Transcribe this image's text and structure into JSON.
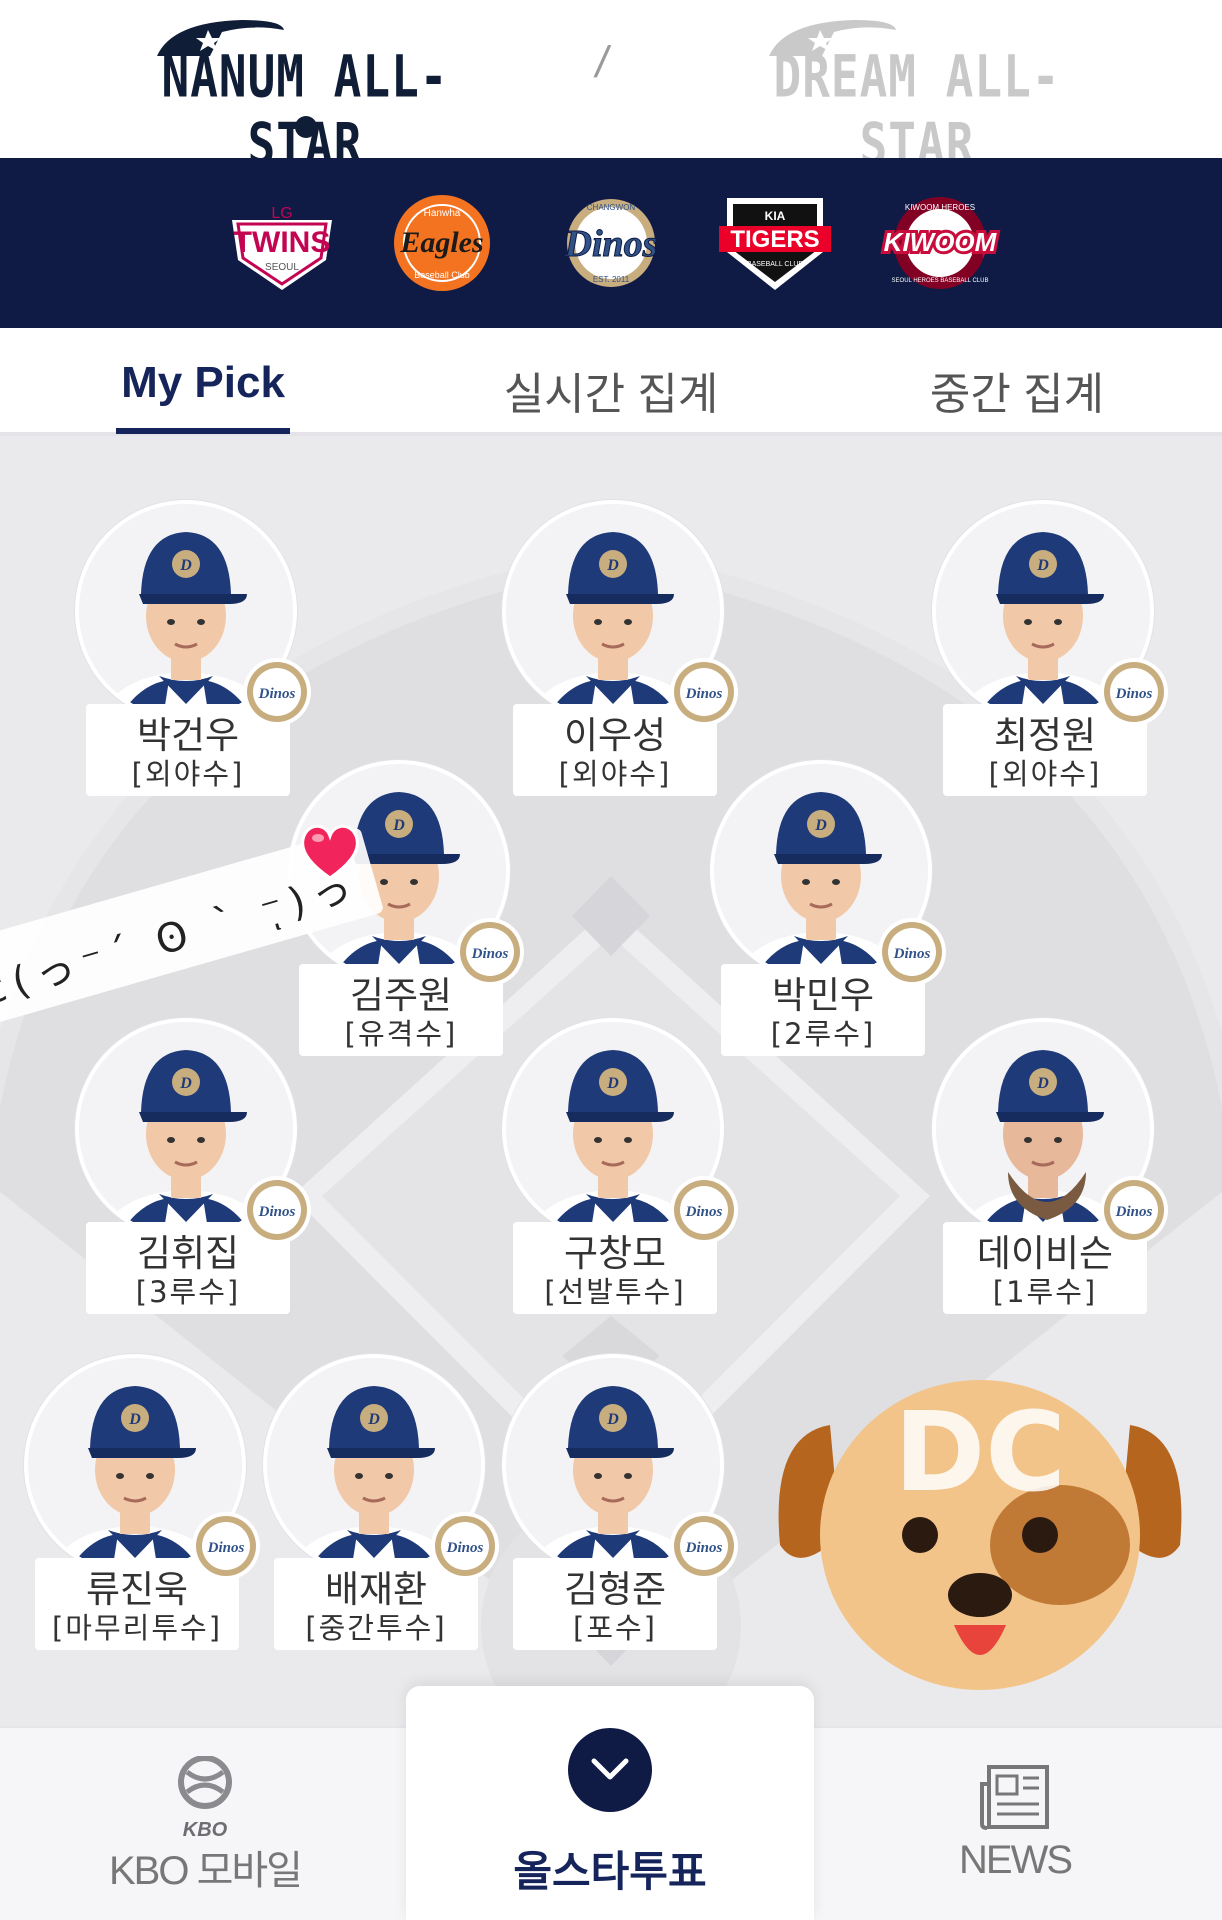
{
  "league_switcher": {
    "nanum": {
      "label": "NANUM ALL-STAR",
      "active": true
    },
    "separator": "/",
    "dream": {
      "label": "DREAM ALL-STAR",
      "active": false
    }
  },
  "teams": [
    {
      "name": "LG TWINS",
      "top": "LG",
      "main": "TWINS",
      "sub": "SEOUL",
      "color": "#c30452"
    },
    {
      "name": "Hanwha Eagles",
      "top": "Hanwha",
      "main": "Eagles",
      "sub": "Baseball Club",
      "color": "#f37321"
    },
    {
      "name": "NC Dinos",
      "top": "CHANGWON",
      "main": "Dinos",
      "sub": "EST. 2011",
      "color": "#315288"
    },
    {
      "name": "KIA TIGERS",
      "top": "KIA",
      "main": "TIGERS",
      "sub": "BASEBALL CLUB",
      "color": "#ea0029"
    },
    {
      "name": "KIWOOM HEROES",
      "top": "KIWOOM HEROES",
      "main": "KIWOOM",
      "sub": "SEOUL HEROES BASEBALL CLUB",
      "color": "#820024"
    }
  ],
  "tabs": [
    {
      "label": "My Pick",
      "active": true
    },
    {
      "label": "실시간 집계",
      "active": false
    },
    {
      "label": "중간 집계",
      "active": false
    }
  ],
  "players": [
    {
      "name": "박건우",
      "position": "[외야수]",
      "beard": false
    },
    {
      "name": "이우성",
      "position": "[외야수]",
      "beard": false
    },
    {
      "name": "최정원",
      "position": "[외야수]",
      "beard": false
    },
    {
      "name": "김주원",
      "position": "[유격수]",
      "beard": false
    },
    {
      "name": "박민우",
      "position": "[2루수]",
      "beard": false
    },
    {
      "name": "김휘집",
      "position": "[3루수]",
      "beard": false
    },
    {
      "name": "구창모",
      "position": "[선발투수]",
      "beard": false
    },
    {
      "name": "데이비슨",
      "position": "[1루수]",
      "beard": true
    },
    {
      "name": "류진욱",
      "position": "[마무리투수]",
      "beard": false
    },
    {
      "name": "배재환",
      "position": "[중간투수]",
      "beard": false
    },
    {
      "name": "김형준",
      "position": "[포수]",
      "beard": false
    }
  ],
  "team_badge": "Dinos",
  "sticker_text": "ε(っ⁻´ ʘ ` ⁻ͅ)っ",
  "dog_sticker_text": "DC",
  "bottom_nav": {
    "left": {
      "logo": "KBO",
      "label": "KBO 모바일"
    },
    "center": {
      "label": "올스타투표",
      "icon": "chevron-down-icon"
    },
    "right": {
      "label": "NEWS",
      "icon": "newspaper-icon"
    }
  }
}
